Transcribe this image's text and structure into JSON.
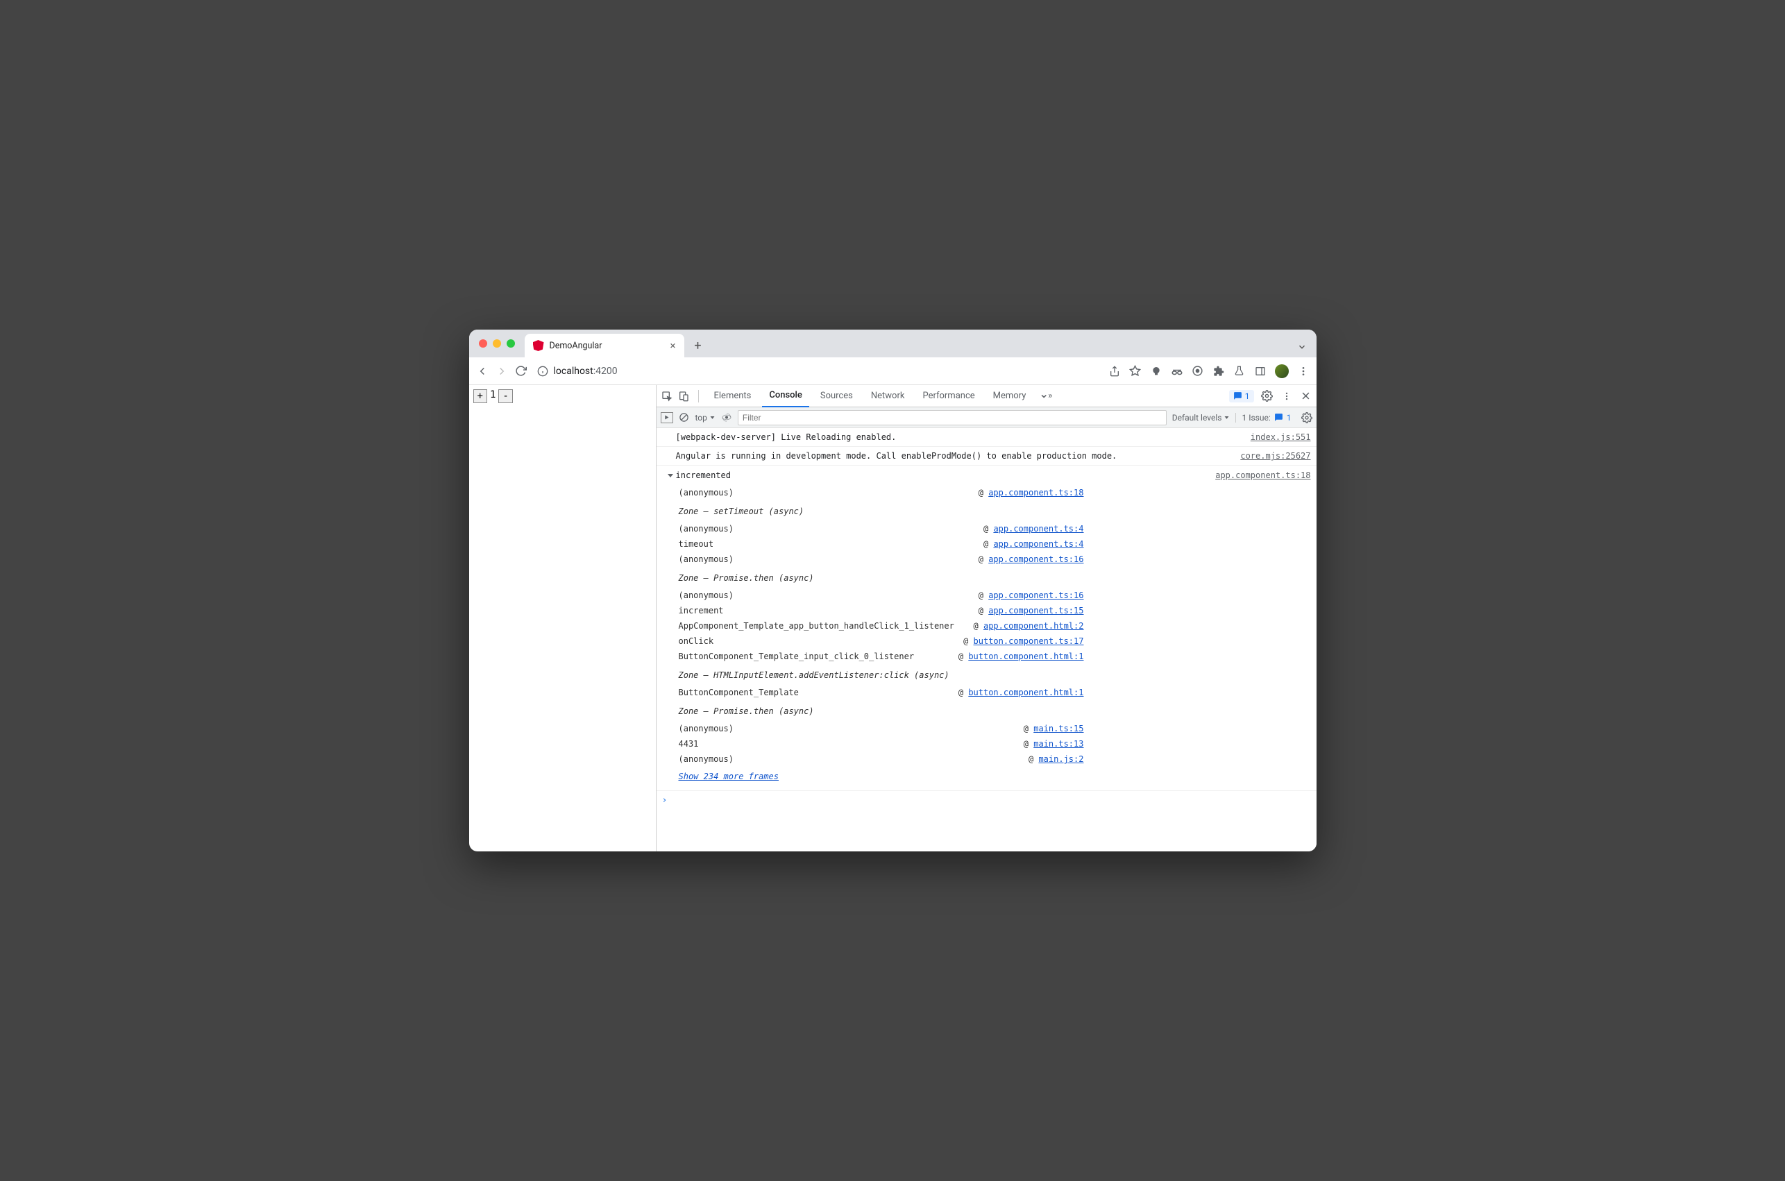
{
  "browser": {
    "tab_title": "DemoAngular",
    "url_host": "localhost",
    "url_port": ":4200"
  },
  "page": {
    "plus": "+",
    "counter": "1",
    "minus": "-"
  },
  "devtools": {
    "tabs": [
      "Elements",
      "Console",
      "Sources",
      "Network",
      "Performance",
      "Memory"
    ],
    "active_tab": "Console",
    "msg_badge": "1",
    "context": "top",
    "filter_placeholder": "Filter",
    "levels": "Default levels",
    "issues_label": "1 Issue:",
    "issues_count": "1"
  },
  "console": {
    "messages": [
      {
        "text": "[webpack-dev-server] Live Reloading enabled.",
        "src": "index.js:551"
      },
      {
        "text": "Angular is running in development mode. Call enableProdMode() to enable production mode.",
        "src": "core.mjs:25627"
      }
    ],
    "trace": {
      "label": "incremented",
      "src": "app.component.ts:18",
      "frames": [
        {
          "fn": "(anonymous)",
          "link": "app.component.ts:18"
        },
        {
          "zone": "Zone — setTimeout (async)"
        },
        {
          "fn": "(anonymous)",
          "link": "app.component.ts:4"
        },
        {
          "fn": "timeout",
          "link": "app.component.ts:4"
        },
        {
          "fn": "(anonymous)",
          "link": "app.component.ts:16"
        },
        {
          "zone": "Zone — Promise.then (async)"
        },
        {
          "fn": "(anonymous)",
          "link": "app.component.ts:16"
        },
        {
          "fn": "increment",
          "link": "app.component.ts:15"
        },
        {
          "fn": "AppComponent_Template_app_button_handleClick_1_listener",
          "link": "app.component.html:2"
        },
        {
          "fn": "onClick",
          "link": "button.component.ts:17"
        },
        {
          "fn": "ButtonComponent_Template_input_click_0_listener",
          "link": "button.component.html:1"
        },
        {
          "zone": "Zone — HTMLInputElement.addEventListener:click (async)"
        },
        {
          "fn": "ButtonComponent_Template",
          "link": "button.component.html:1"
        },
        {
          "zone": "Zone — Promise.then (async)"
        },
        {
          "fn": "(anonymous)",
          "link": "main.ts:15"
        },
        {
          "fn": "4431",
          "link": "main.ts:13"
        },
        {
          "fn": "(anonymous)",
          "link": "main.js:2"
        }
      ],
      "show_more": "Show 234 more frames"
    },
    "prompt": "›"
  }
}
